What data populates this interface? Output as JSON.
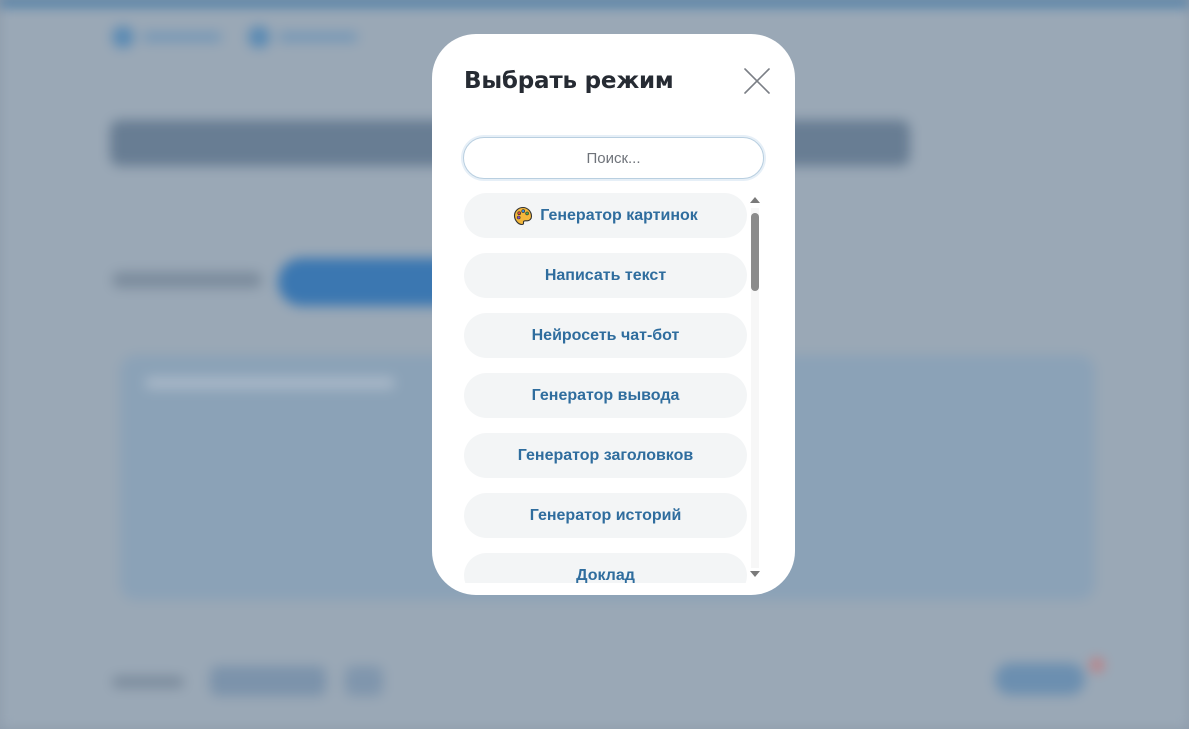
{
  "modal": {
    "title": "Выбрать режим",
    "search": {
      "placeholder": "Поиск...",
      "value": ""
    },
    "items": [
      {
        "label": "Генератор картинок",
        "icon": "palette-icon"
      },
      {
        "label": "Написать текст"
      },
      {
        "label": "Нейросеть чат-бот"
      },
      {
        "label": "Генератор вывода"
      },
      {
        "label": "Генератор заголовков"
      },
      {
        "label": "Генератор историй"
      },
      {
        "label": "Доклад"
      }
    ]
  },
  "colors": {
    "accent_text": "#2f6d9e",
    "item_bg": "#f3f5f6",
    "title": "#262b33",
    "overlay": "#8d9bab"
  }
}
